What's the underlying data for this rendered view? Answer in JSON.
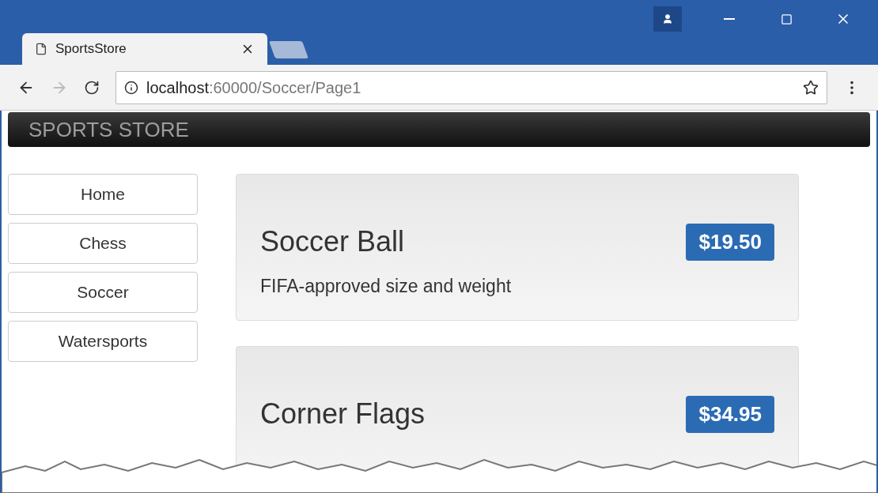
{
  "tab": {
    "title": "SportsStore"
  },
  "address": {
    "host": "localhost",
    "path": ":60000/Soccer/Page1"
  },
  "navbar": {
    "brand": "SPORTS STORE"
  },
  "categories": [
    {
      "label": "Home"
    },
    {
      "label": "Chess"
    },
    {
      "label": "Soccer"
    },
    {
      "label": "Watersports"
    }
  ],
  "products": [
    {
      "name": "Soccer Ball",
      "price": "$19.50",
      "description": "FIFA-approved size and weight"
    },
    {
      "name": "Corner Flags",
      "price": "$34.95"
    }
  ]
}
